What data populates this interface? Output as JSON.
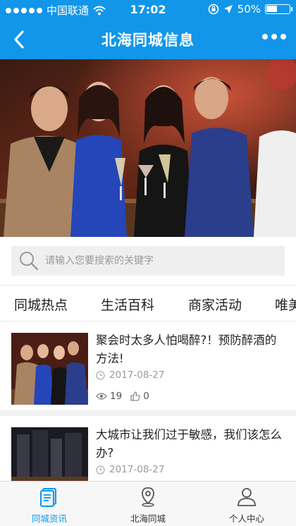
{
  "status_bar": {
    "carrier": "中国联通",
    "time": "17:02",
    "battery": "50%"
  },
  "navbar": {
    "title": "北海同城信息",
    "back_icon": "chevron-left-icon",
    "more_icon": "more-dots-icon"
  },
  "banner": {
    "image": "people-toasting-at-bar-photo"
  },
  "search": {
    "placeholder": "请输入您要搜索的关键字"
  },
  "category_tabs": [
    "同城热点",
    "生活百科",
    "商家活动",
    "唯美"
  ],
  "articles": [
    {
      "title": "聚会时太多人怕喝醉?！预防醉酒的方法!",
      "date": "2017-08-27",
      "views": "19",
      "likes": "0"
    },
    {
      "title": "大城市让我们过于敏感，我们该怎么办?",
      "date": "2017-08-27"
    }
  ],
  "tabbar": {
    "items": [
      {
        "label": "同城资讯",
        "active": true
      },
      {
        "label": "北海同城",
        "active": false
      },
      {
        "label": "个人中心",
        "active": false
      }
    ]
  },
  "colors": {
    "primary": "#1296ea"
  }
}
